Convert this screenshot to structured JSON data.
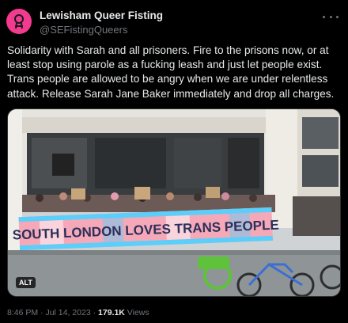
{
  "tweet": {
    "display_name": "Lewisham Queer Fisting",
    "handle": "@SEFistingQueers",
    "text": "Solidarity with Sarah and all prisoners. Fire to the prisons now, or at least stop using parole as a fucking leash and just let people exist. Trans people are allowed to be angry when we are under relentless attack. Release Sarah Jane Baker immediately and drop all charges.",
    "media": {
      "banner_text": "SOUTH LONDON LOVES TRANS PEOPLE",
      "alt_label": "ALT"
    },
    "time": "8:46 PM",
    "date": "Jul 14, 2023",
    "separator": "·",
    "views_count": "179.1K",
    "views_label": "Views"
  },
  "colors": {
    "background": "#000000",
    "text": "#e7e9ea",
    "secondary_text": "#71767b",
    "avatar": "#f23a8e",
    "banner_pink": "#f5a9b8",
    "banner_blue": "#5bcefa",
    "banner_text": "#2b2f5a"
  },
  "icons": [
    "avatar-logo-icon",
    "more-options-icon"
  ]
}
